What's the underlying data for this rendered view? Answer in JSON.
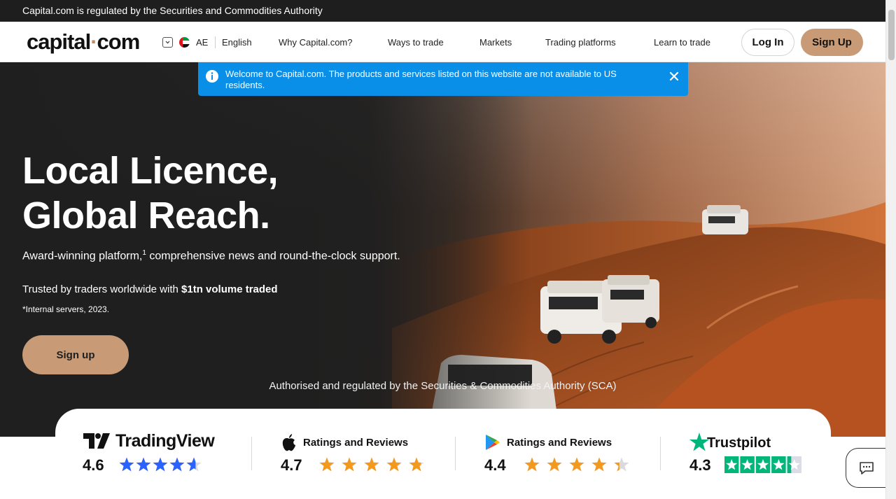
{
  "topbar": {
    "text": "Capital.com is regulated by the Securities and Commodities Authority"
  },
  "header": {
    "logo_main": "capital",
    "logo_dot": "·",
    "logo_tail": "com",
    "country_code": "AE",
    "language": "English",
    "nav": [
      "Why Capital.com?",
      "Ways to trade",
      "Markets",
      "Trading platforms",
      "Learn to trade"
    ],
    "login_label": "Log In",
    "signup_label": "Sign Up"
  },
  "notice": {
    "text": "Welcome to Capital.com. The products and services listed on this website are not available to US residents.",
    "icon": "info-icon",
    "close_icon": "close-icon"
  },
  "hero": {
    "title_line1": "Local Licence,",
    "title_line2": "Global Reach.",
    "sub_before": "Award-winning platform,",
    "sub_sup": "1",
    "sub_after": " comprehensive news and round-the-clock support.",
    "trust_before": "Trusted by traders worldwide with ",
    "trust_bold": "$1tn volume traded",
    "footnote": "*Internal servers, 2023.",
    "cta_label": "Sign up",
    "regulated": "Authorised and regulated by the Securities & Commodities Authority (SCA)"
  },
  "ratings": [
    {
      "source": "TradingView",
      "label": "",
      "score": "4.6",
      "stars": 4.6,
      "star_color": "#2962ff"
    },
    {
      "source": "App Store",
      "label": "Ratings and Reviews",
      "score": "4.7",
      "stars": 4.7,
      "star_color": "#f39a1e"
    },
    {
      "source": "Google Play",
      "label": "Ratings and Reviews",
      "score": "4.4",
      "stars": 4.4,
      "star_color": "#f39a1e"
    },
    {
      "source": "Trustpilot",
      "label": "",
      "score": "4.3",
      "stars": 4.3,
      "star_color": "#00b67a"
    }
  ],
  "colors": {
    "accent": "#c89b76",
    "topbar": "#1e1e1e",
    "notice": "#0a8fe8"
  }
}
